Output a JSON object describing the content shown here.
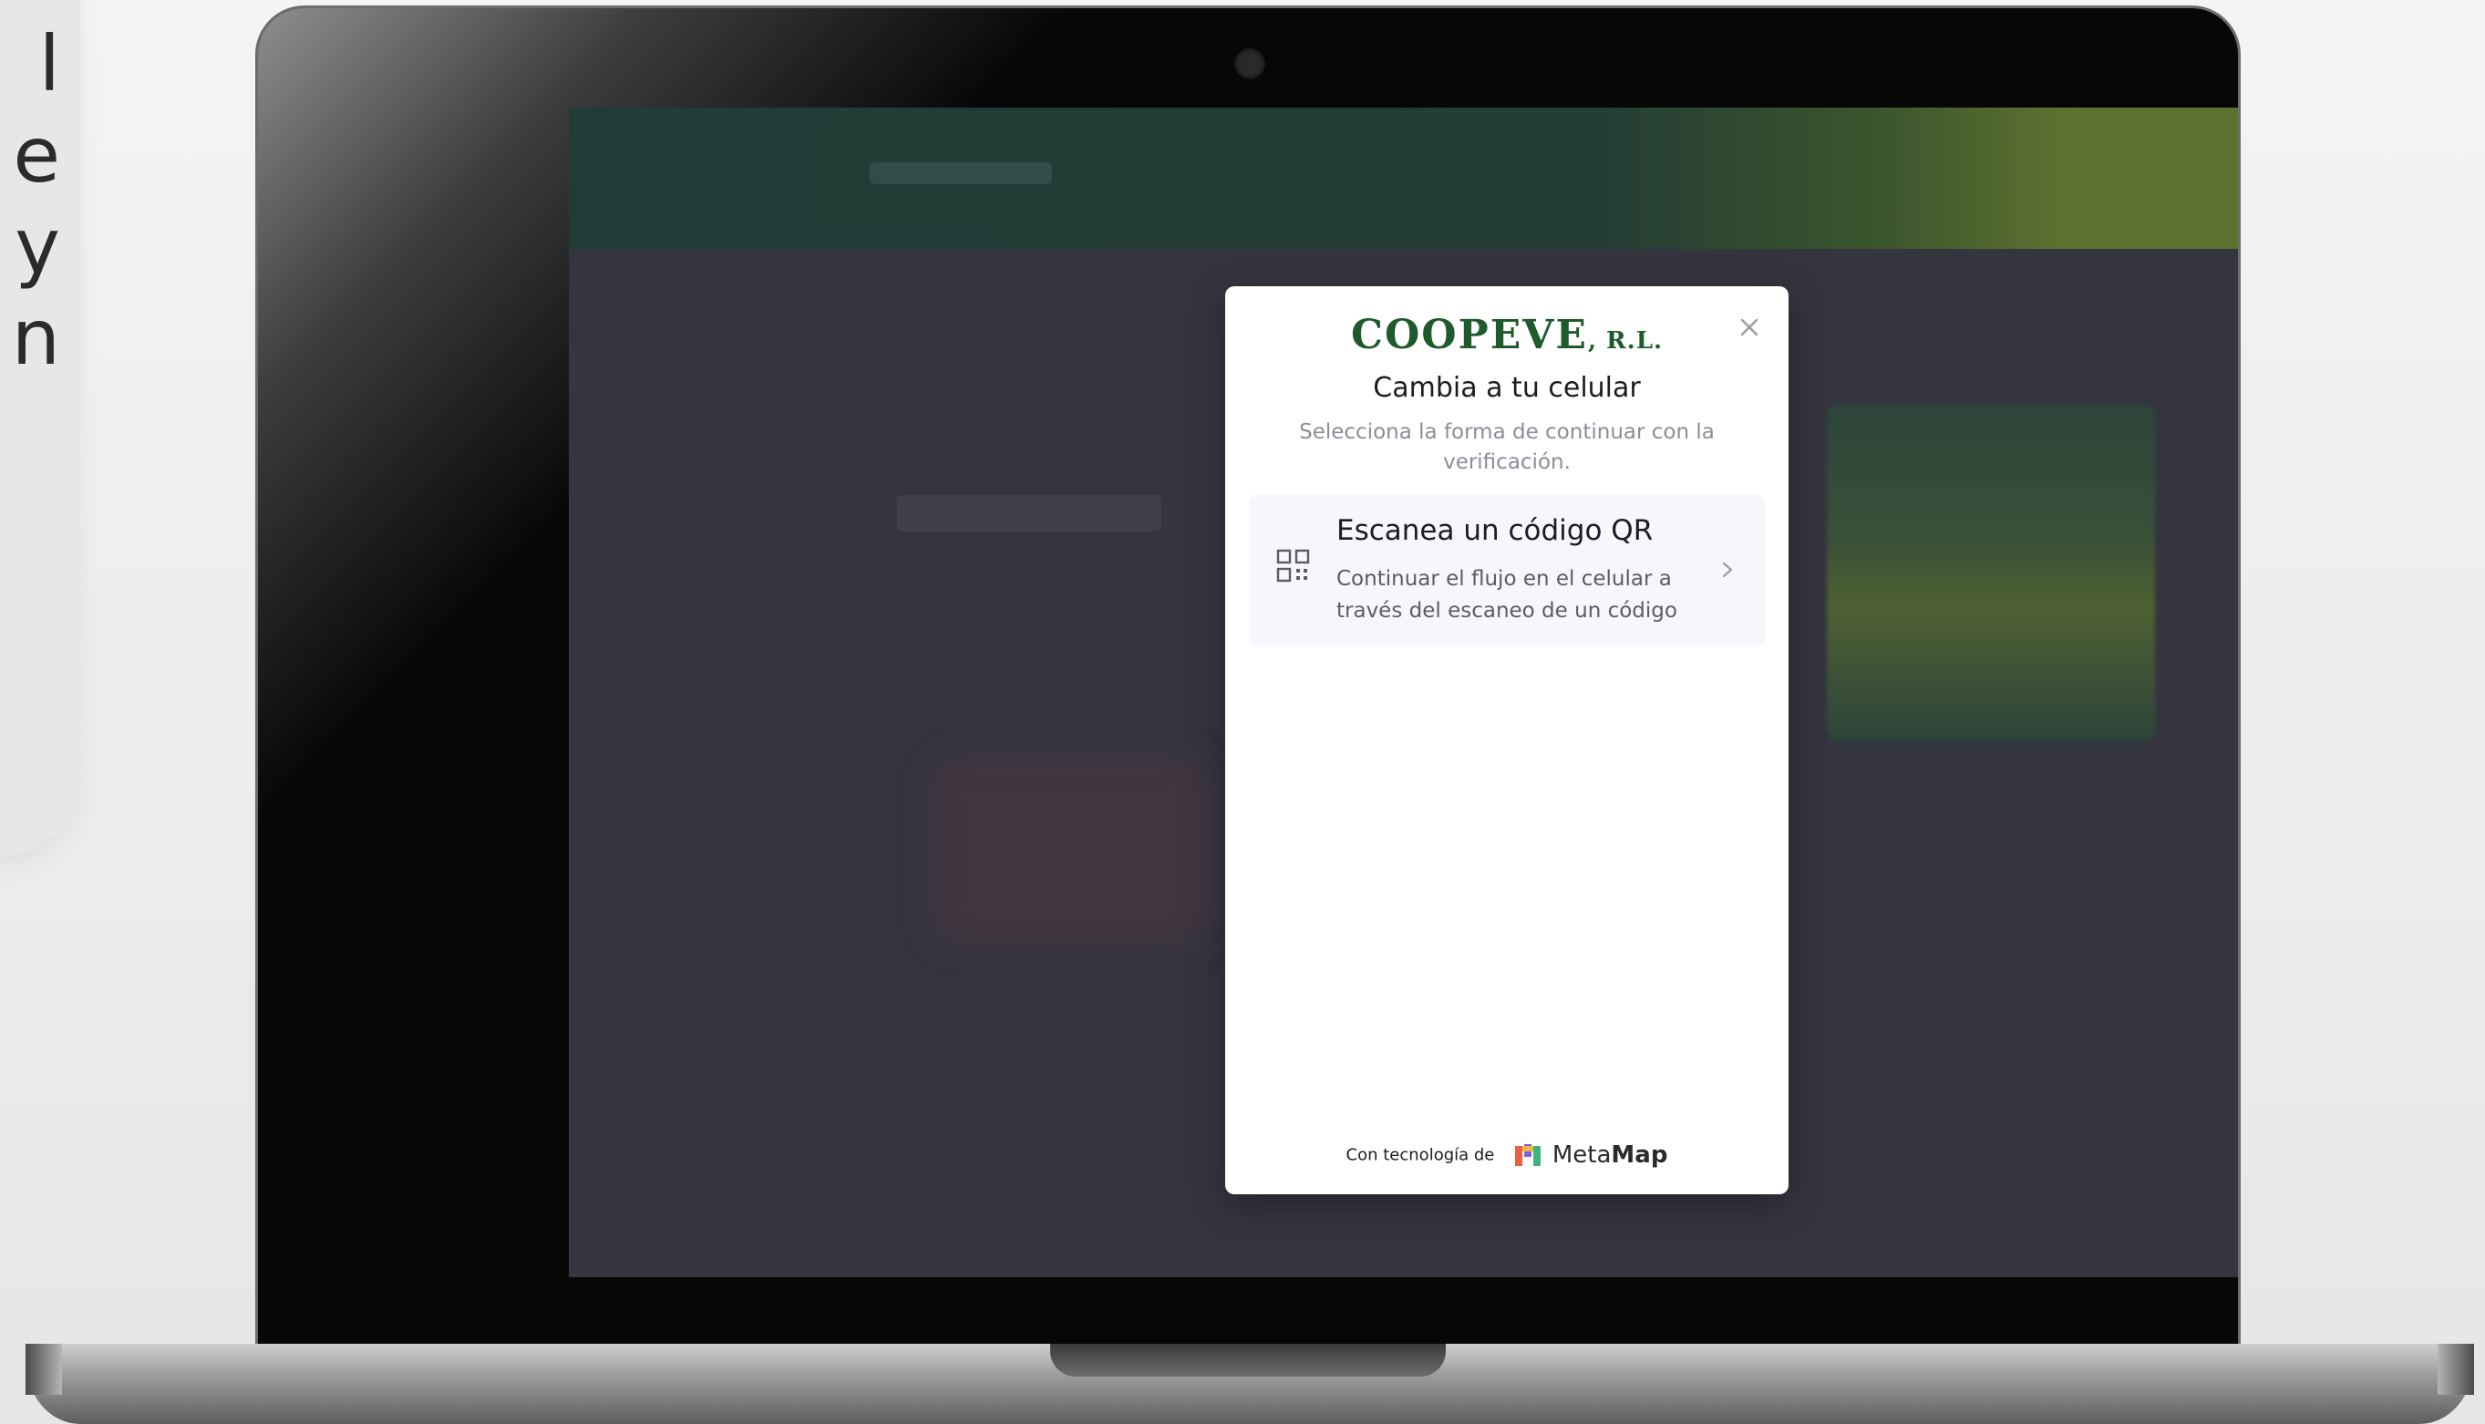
{
  "side_card": {
    "letters": [
      "l",
      "e",
      "y",
      "n"
    ]
  },
  "modal": {
    "brand": "COOPEVE",
    "brand_suffix": ", R.L.",
    "title": "Cambia a tu celular",
    "subtitle": "Selecciona la forma de continuar con la verificación.",
    "option": {
      "icon": "qr-code-icon",
      "title": "Escanea un código QR",
      "description": "Continuar el flujo en el celular a través del escaneo de un código"
    },
    "footer": {
      "powered_by": "Con tecnología de",
      "provider_prefix": "Meta",
      "provider_bold": "Map"
    }
  },
  "colors": {
    "brand_green": "#1e5a2b",
    "overlay": "#34353f",
    "option_bg": "#f6f6fb"
  }
}
